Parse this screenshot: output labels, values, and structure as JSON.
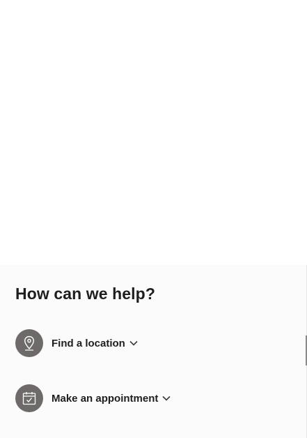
{
  "help": {
    "heading": "How can we help?",
    "items": [
      {
        "label": "Find a location",
        "icon": "location-pin-icon"
      },
      {
        "label": "Make an appointment",
        "icon": "calendar-check-icon"
      }
    ]
  },
  "colors": {
    "icon_background": "#6f6a6a",
    "text": "#1e1e1e",
    "section_background": "#fbfbfb"
  }
}
